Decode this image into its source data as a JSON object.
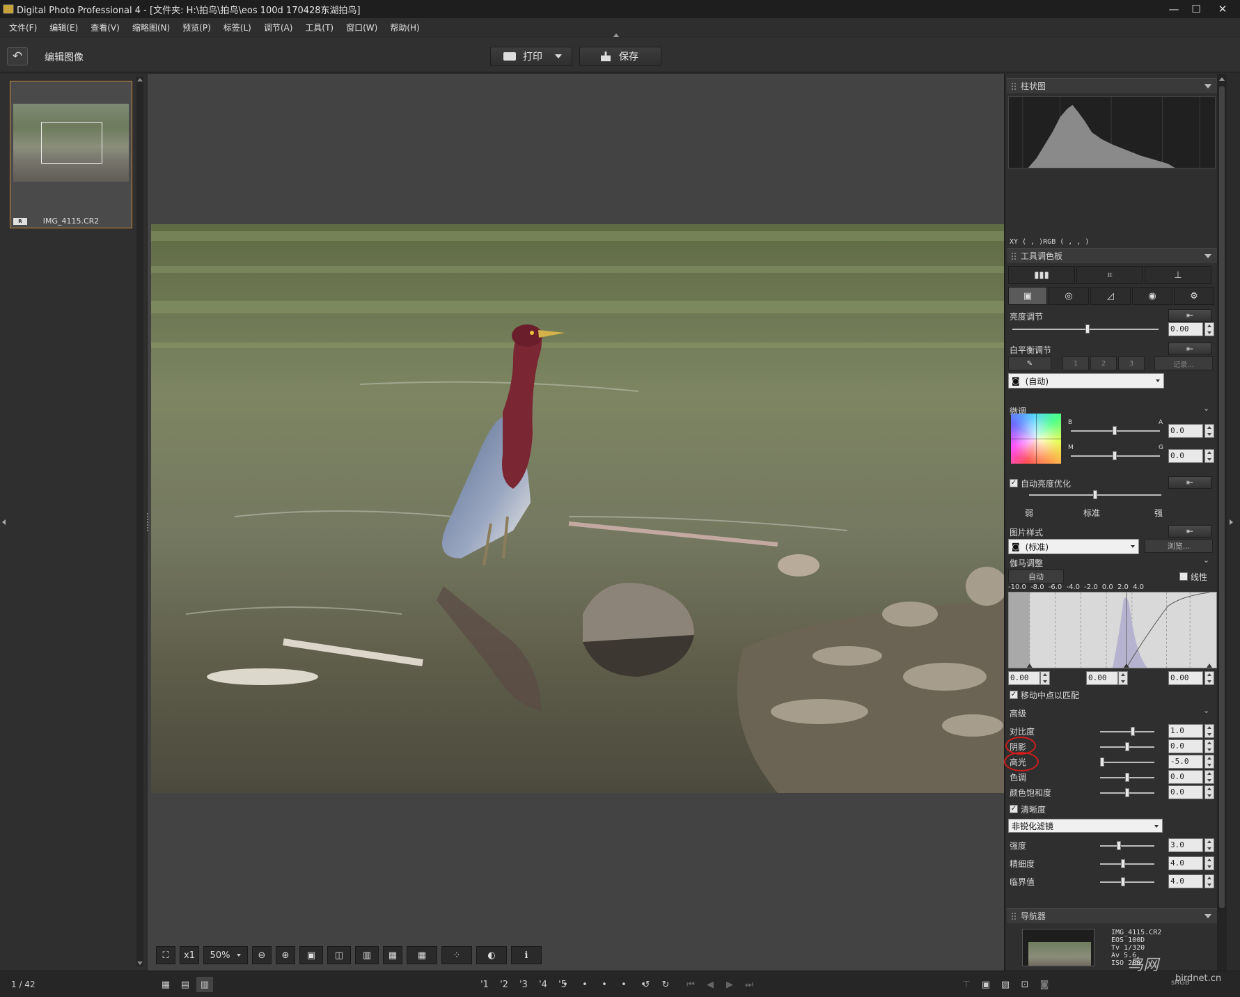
{
  "window": {
    "title": "Digital Photo Professional 4 - [文件夹: H:\\拍鸟\\拍鸟\\eos 100d 170428东湖拍鸟]",
    "minimize": "—",
    "maximize": "☐",
    "close": "✕"
  },
  "menu": [
    "文件(F)",
    "编辑(E)",
    "查看(V)",
    "缩略图(N)",
    "预览(P)",
    "标签(L)",
    "调节(A)",
    "工具(T)",
    "窗口(W)",
    "帮助(H)"
  ],
  "toolbar": {
    "back_icon": "↶",
    "title": "编辑图像",
    "print_label": "打印",
    "save_label": "保存"
  },
  "filmstrip": {
    "file_name": "IMG_4115.CR2",
    "raw_badge": "R"
  },
  "status": {
    "page_count": "1 / 42"
  },
  "viewer_tools": {
    "fit_icon": "⛶",
    "x1": "x1",
    "zoom": "50%",
    "zoom_out": "⊖",
    "zoom_in": "⊕"
  },
  "rating_buttons": [
    "'1",
    "'2",
    "'3",
    "'4",
    "'5"
  ],
  "right_panel": {
    "histogram": {
      "title": "柱状图",
      "readout": "XY (    ,    )RGB (    ,    ,    )"
    },
    "tool_palette_title": "工具调色板",
    "brightness": {
      "label": "亮度调节",
      "value": "0.00",
      "level": 0.5
    },
    "white_balance": {
      "label": "白平衡调节",
      "slots": [
        "1",
        "2",
        "3"
      ],
      "register": "记录...",
      "mode": "(自动)"
    },
    "fine_tune": {
      "label": "微调",
      "b_label": "B",
      "a_label": "A",
      "m_label": "M",
      "g_label": "G",
      "ba_value": "0.0",
      "mg_value": "0.0"
    },
    "alo": {
      "label": "自动亮度优化",
      "low": "弱",
      "std": "标准",
      "high": "强"
    },
    "picture_style": {
      "label": "图片样式",
      "value": "(标准)",
      "browse": "浏览..."
    },
    "gamma": {
      "label": "伽马调整",
      "auto": "自动",
      "linear": "线性",
      "scale": [
        "-10.0",
        "-8.0",
        "-6.0",
        "-4.0",
        "-2.0",
        "0.0",
        "2.0",
        "4.0"
      ],
      "values": [
        "0.00",
        "0.00",
        "0.00"
      ],
      "move_mid": "移动中点以匹配"
    },
    "advanced": {
      "label": "高级",
      "rows": [
        {
          "label": "对比度",
          "value": "1.0"
        },
        {
          "label": "阴影",
          "value": "0.0"
        },
        {
          "label": "高光",
          "value": "-5.0"
        },
        {
          "label": "色调",
          "value": "0.0"
        },
        {
          "label": "颜色饱和度",
          "value": "0.0"
        }
      ]
    },
    "sharpness": {
      "label": "清晰度",
      "filter": "非锐化滤镜",
      "rows": [
        {
          "label": "强度",
          "value": "3.0"
        },
        {
          "label": "精细度",
          "value": "4.0"
        },
        {
          "label": "临界值",
          "value": "4.0"
        }
      ]
    },
    "navigator": {
      "title": "导航器",
      "info": "IMG_4115.CR2\nEOS 100D\nTv 1/320\nAv 5.6\nISO 200"
    }
  },
  "watermark": {
    "main": "鸟网",
    "sub": "birdnet.cn",
    "srgb": "sRGB"
  }
}
